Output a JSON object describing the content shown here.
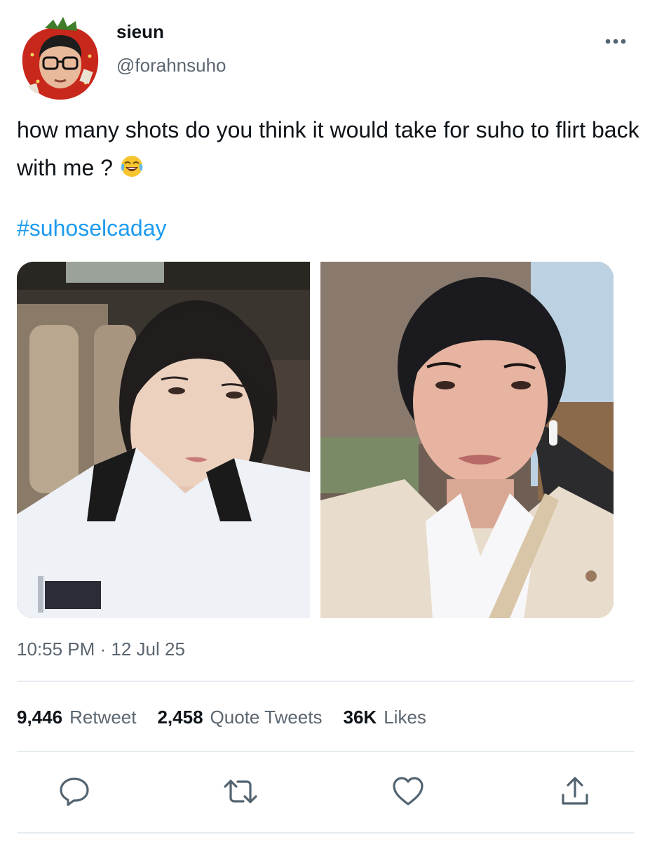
{
  "user": {
    "display_name": "sieun",
    "handle": "@forahnsuho",
    "avatar_icon": "strawberry-avatar-icon"
  },
  "tweet": {
    "text": "how many shots do you think it would take for suho to flirt back with me ?",
    "emoji": "face-with-tears-of-joy-icon",
    "hashtag": "#suhoselcaday",
    "timestamp": "10:55 PM · 12 Jul 25"
  },
  "stats": {
    "retweets_count": "9,446",
    "retweets_label": "Retweet",
    "quotes_count": "2,458",
    "quotes_label": "Quote Tweets",
    "likes_count": "36K",
    "likes_label": "Likes"
  },
  "actions": {
    "reply_icon": "reply-icon",
    "retweet_icon": "retweet-icon",
    "like_icon": "heart-icon",
    "share_icon": "share-icon"
  },
  "colors": {
    "accent": "#1d9bf0",
    "text_primary": "#0f1419",
    "text_secondary": "#5b6670",
    "icon": "#536471",
    "divider": "#e6ecf0"
  }
}
